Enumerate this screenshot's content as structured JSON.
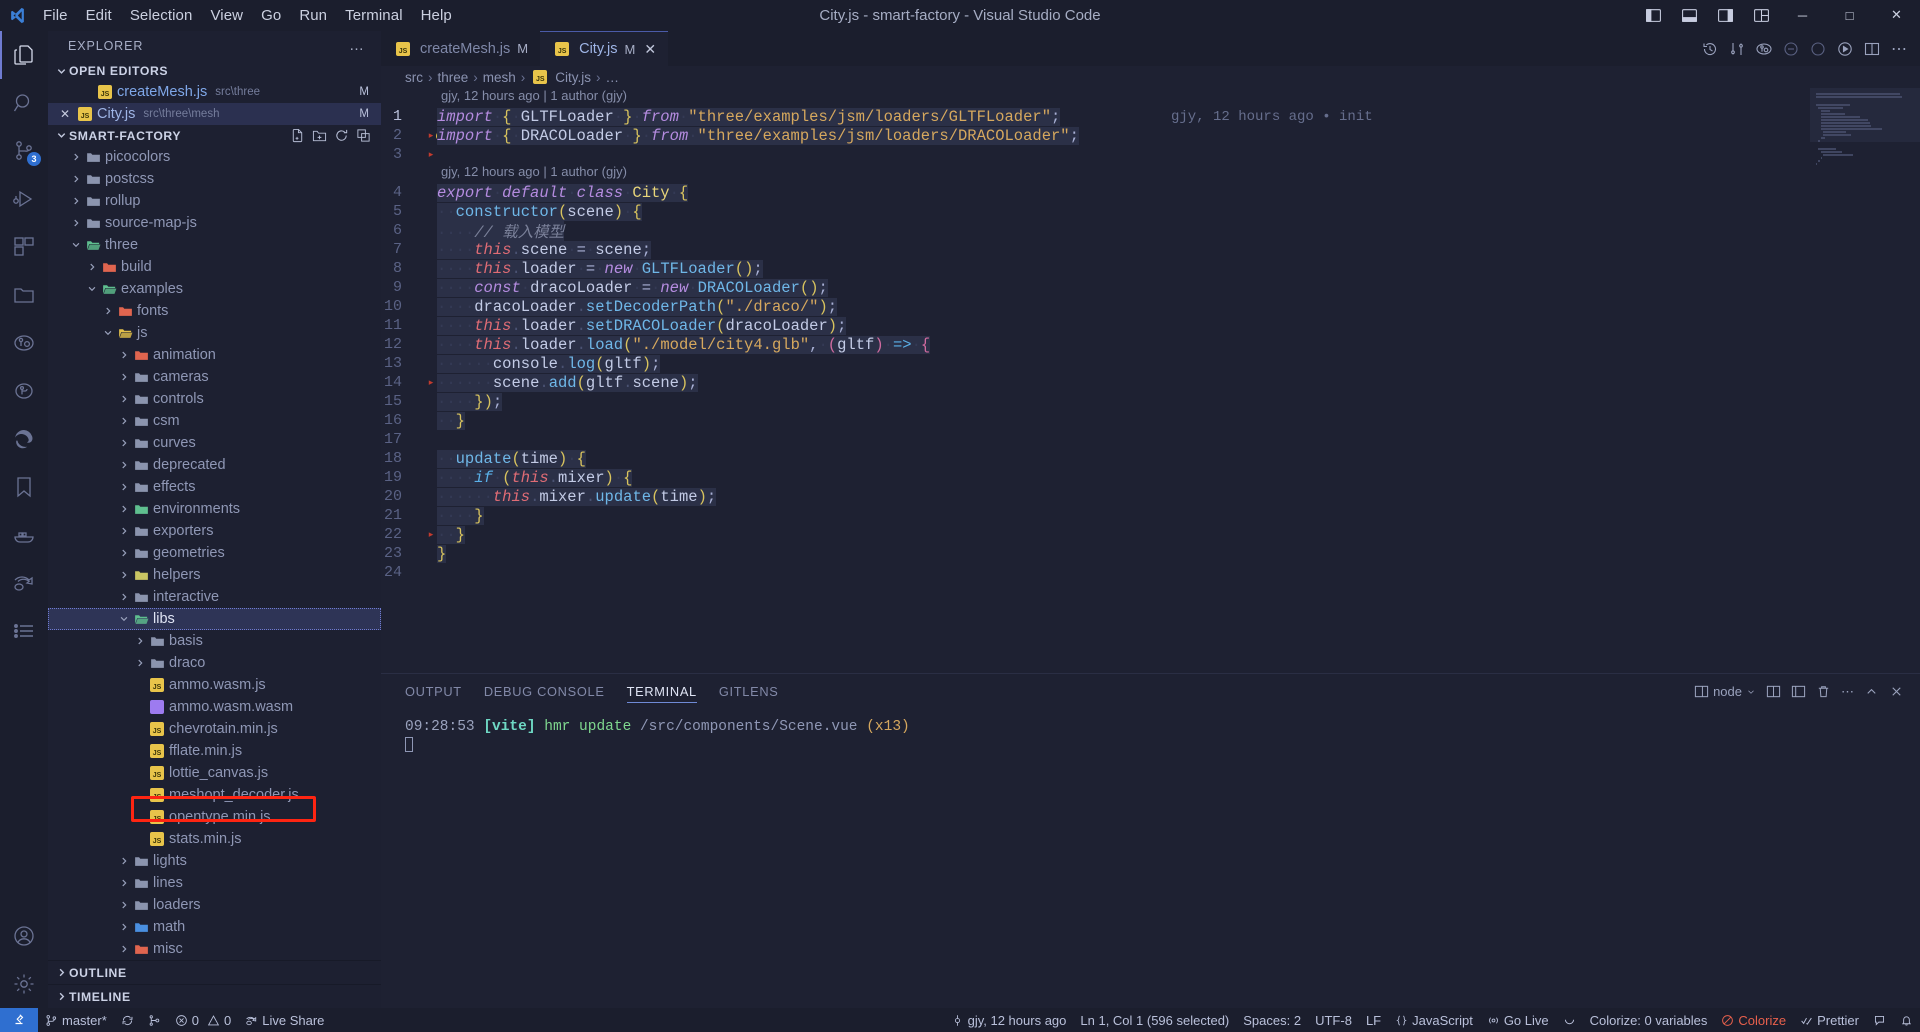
{
  "titlebar": {
    "window_title": "City.js - smart-factory - Visual Studio Code",
    "menus": [
      "File",
      "Edit",
      "Selection",
      "View",
      "Go",
      "Run",
      "Terminal",
      "Help"
    ],
    "window_buttons": {
      "minimize": "─",
      "maximize": "□",
      "close": "✕"
    }
  },
  "activitybar": {
    "items": [
      {
        "name": "explorer",
        "icon": "files-icon",
        "badge": ""
      },
      {
        "name": "search",
        "icon": "search-icon",
        "badge": ""
      },
      {
        "name": "source-control",
        "icon": "source-control-icon",
        "badge": "3"
      },
      {
        "name": "run-and-debug",
        "icon": "debug-icon",
        "badge": ""
      },
      {
        "name": "extensions",
        "icon": "extensions-icon",
        "badge": ""
      },
      {
        "name": "remote-explorer",
        "icon": "folder-icon",
        "badge": ""
      },
      {
        "name": "gitlens",
        "icon": "gitlens-icon",
        "badge": ""
      },
      {
        "name": "git-graph",
        "icon": "git-graph-icon",
        "badge": ""
      },
      {
        "name": "edge-tools",
        "icon": "edge-icon",
        "badge": ""
      },
      {
        "name": "bookmarks",
        "icon": "bookmark-icon",
        "badge": ""
      },
      {
        "name": "docker",
        "icon": "docker-icon",
        "badge": ""
      },
      {
        "name": "live-share",
        "icon": "live-share-icon",
        "badge": ""
      },
      {
        "name": "todo-tree",
        "icon": "list-icon",
        "badge": ""
      }
    ],
    "bottom": [
      {
        "name": "accounts",
        "icon": "account-icon"
      },
      {
        "name": "settings",
        "icon": "gear-icon"
      }
    ]
  },
  "sidebar": {
    "title": "EXPLORER",
    "more_label": "…",
    "open_editors": {
      "label": "OPEN EDITORS",
      "items": [
        {
          "name": "createMesh.js",
          "path": "src\\three",
          "badge": "M",
          "icon": "js-icon",
          "active": false
        },
        {
          "name": "City.js",
          "path": "src\\three\\mesh",
          "badge": "M",
          "icon": "js-icon",
          "active": true
        }
      ]
    },
    "project": {
      "label": "SMART-FACTORY",
      "actions": [
        "new-file-icon",
        "new-folder-icon",
        "refresh-icon",
        "collapse-all-icon"
      ],
      "tree": [
        {
          "label": "picocolors",
          "depth": 1,
          "type": "folder",
          "open": false,
          "color": "gray"
        },
        {
          "label": "postcss",
          "depth": 1,
          "type": "folder",
          "open": false,
          "color": "gray"
        },
        {
          "label": "rollup",
          "depth": 1,
          "type": "folder",
          "open": false,
          "color": "gray"
        },
        {
          "label": "source-map-js",
          "depth": 1,
          "type": "folder",
          "open": false,
          "color": "gray"
        },
        {
          "label": "three",
          "depth": 1,
          "type": "folder",
          "open": true,
          "color": "green"
        },
        {
          "label": "build",
          "depth": 2,
          "type": "folder",
          "open": false,
          "color": "red"
        },
        {
          "label": "examples",
          "depth": 2,
          "type": "folder",
          "open": true,
          "color": "green"
        },
        {
          "label": "fonts",
          "depth": 3,
          "type": "folder",
          "open": false,
          "color": "red"
        },
        {
          "label": "js",
          "depth": 3,
          "type": "folder",
          "open": true,
          "color": "yellow"
        },
        {
          "label": "animation",
          "depth": 4,
          "type": "folder",
          "open": false,
          "color": "red"
        },
        {
          "label": "cameras",
          "depth": 4,
          "type": "folder",
          "open": false,
          "color": "gray"
        },
        {
          "label": "controls",
          "depth": 4,
          "type": "folder",
          "open": false,
          "color": "gray"
        },
        {
          "label": "csm",
          "depth": 4,
          "type": "folder",
          "open": false,
          "color": "gray"
        },
        {
          "label": "curves",
          "depth": 4,
          "type": "folder",
          "open": false,
          "color": "gray"
        },
        {
          "label": "deprecated",
          "depth": 4,
          "type": "folder",
          "open": false,
          "color": "gray"
        },
        {
          "label": "effects",
          "depth": 4,
          "type": "folder",
          "open": false,
          "color": "gray"
        },
        {
          "label": "environments",
          "depth": 4,
          "type": "folder",
          "open": false,
          "color": "green"
        },
        {
          "label": "exporters",
          "depth": 4,
          "type": "folder",
          "open": false,
          "color": "gray"
        },
        {
          "label": "geometries",
          "depth": 4,
          "type": "folder",
          "open": false,
          "color": "gray"
        },
        {
          "label": "helpers",
          "depth": 4,
          "type": "folder",
          "open": false,
          "color": "olive"
        },
        {
          "label": "interactive",
          "depth": 4,
          "type": "folder",
          "open": false,
          "color": "gray"
        },
        {
          "label": "libs",
          "depth": 4,
          "type": "folder",
          "open": true,
          "color": "green",
          "state": "focused"
        },
        {
          "label": "basis",
          "depth": 5,
          "type": "folder",
          "open": false,
          "color": "gray"
        },
        {
          "label": "draco",
          "depth": 5,
          "type": "folder",
          "open": false,
          "color": "gray",
          "state": "highlighted"
        },
        {
          "label": "ammo.wasm.js",
          "depth": 5,
          "type": "file",
          "icon": "js-icon"
        },
        {
          "label": "ammo.wasm.wasm",
          "depth": 5,
          "type": "file",
          "icon": "wasm-icon"
        },
        {
          "label": "chevrotain.min.js",
          "depth": 5,
          "type": "file",
          "icon": "js-icon"
        },
        {
          "label": "fflate.min.js",
          "depth": 5,
          "type": "file",
          "icon": "js-icon"
        },
        {
          "label": "lottie_canvas.js",
          "depth": 5,
          "type": "file",
          "icon": "js-icon"
        },
        {
          "label": "meshopt_decoder.js",
          "depth": 5,
          "type": "file",
          "icon": "js-icon"
        },
        {
          "label": "opentype.min.js",
          "depth": 5,
          "type": "file",
          "icon": "js-icon"
        },
        {
          "label": "stats.min.js",
          "depth": 5,
          "type": "file",
          "icon": "js-icon"
        },
        {
          "label": "lights",
          "depth": 4,
          "type": "folder",
          "open": false,
          "color": "gray"
        },
        {
          "label": "lines",
          "depth": 4,
          "type": "folder",
          "open": false,
          "color": "gray"
        },
        {
          "label": "loaders",
          "depth": 4,
          "type": "folder",
          "open": false,
          "color": "gray"
        },
        {
          "label": "math",
          "depth": 4,
          "type": "folder",
          "open": false,
          "color": "blue"
        },
        {
          "label": "misc",
          "depth": 4,
          "type": "folder",
          "open": false,
          "color": "red"
        }
      ]
    },
    "outline_label": "OUTLINE",
    "timeline_label": "TIMELINE"
  },
  "editor": {
    "tabs": [
      {
        "label": "createMesh.js",
        "badge": "M",
        "icon": "js-icon",
        "active": false,
        "closable": false
      },
      {
        "label": "City.js",
        "badge": "M",
        "icon": "js-icon",
        "active": true,
        "closable": true,
        "close": "✕"
      }
    ],
    "breadcrumb": [
      "src",
      "three",
      "mesh",
      "City.js",
      "…"
    ],
    "codelens": [
      {
        "line": 1,
        "text": "gjy, 12 hours ago | 1 author (gjy)"
      },
      {
        "line": 4,
        "text": "gjy, 12 hours ago | 1 author (gjy)"
      }
    ],
    "inline_blame": "gjy, 12 hours ago • init",
    "lines": [
      {
        "n": 1,
        "text": "import { GLTFLoader } from \"three/examples/jsm/loaders/GLTFLoader\";"
      },
      {
        "n": 2,
        "text": "import { DRACOLoader } from \"three/examples/jsm/loaders/DRACOLoader\";"
      },
      {
        "n": 3,
        "text": ""
      },
      {
        "n": 4,
        "text": "export default class City {"
      },
      {
        "n": 5,
        "text": "  constructor(scene) {"
      },
      {
        "n": 6,
        "text": "    // 载入模型"
      },
      {
        "n": 7,
        "text": "    this.scene = scene;"
      },
      {
        "n": 8,
        "text": "    this.loader = new GLTFLoader();"
      },
      {
        "n": 9,
        "text": "    const dracoLoader = new DRACOLoader();"
      },
      {
        "n": 10,
        "text": "    dracoLoader.setDecoderPath(\"./draco/\");"
      },
      {
        "n": 11,
        "text": "    this.loader.setDRACOLoader(dracoLoader);"
      },
      {
        "n": 12,
        "text": "    this.loader.load(\"./model/city4.glb\", (gltf) => {"
      },
      {
        "n": 13,
        "text": "      console.log(gltf);"
      },
      {
        "n": 14,
        "text": "      scene.add(gltf.scene);"
      },
      {
        "n": 15,
        "text": "    });"
      },
      {
        "n": 16,
        "text": "  }"
      },
      {
        "n": 17,
        "text": ""
      },
      {
        "n": 18,
        "text": "  update(time) {"
      },
      {
        "n": 19,
        "text": "    if (this.mixer) {"
      },
      {
        "n": 20,
        "text": "      this.mixer.update(time);"
      },
      {
        "n": 21,
        "text": "    }"
      },
      {
        "n": 22,
        "text": "  }"
      },
      {
        "n": 23,
        "text": "}"
      },
      {
        "n": 24,
        "text": ""
      }
    ]
  },
  "panel": {
    "tabs": [
      "OUTPUT",
      "DEBUG CONSOLE",
      "TERMINAL",
      "GITLENS"
    ],
    "active_tab": "TERMINAL",
    "shell_label": "node",
    "terminal": {
      "time": "09:28:53",
      "tag": "[vite]",
      "action": "hmr update",
      "path": "/src/components/Scene.vue",
      "count": "(x13)"
    },
    "actions": [
      "split-terminal-icon",
      "new-terminal-icon",
      "layout-icon",
      "trash-icon",
      "more-icon",
      "chevron-up-icon",
      "close-icon"
    ]
  },
  "statusbar": {
    "left": [
      {
        "name": "remote-indicator",
        "icon": "remote-icon",
        "text": ""
      },
      {
        "name": "branch",
        "icon": "branch-icon",
        "text": "master*"
      },
      {
        "name": "sync",
        "icon": "sync-icon",
        "text": ""
      },
      {
        "name": "gitlens-toggle",
        "icon": "gitlens-icon",
        "text": ""
      },
      {
        "name": "problems",
        "icon": "error-icon",
        "text": "0",
        "icon2": "warning-icon",
        "text2": "0"
      },
      {
        "name": "live-share",
        "icon": "live-share-icon",
        "text": "Live Share"
      }
    ],
    "right": [
      {
        "name": "git-blame",
        "icon": "git-commit-icon",
        "text": "gjy, 12 hours ago"
      },
      {
        "name": "cursor-position",
        "icon": "",
        "text": "Ln 1, Col 1 (596 selected)"
      },
      {
        "name": "indentation",
        "icon": "",
        "text": "Spaces: 2"
      },
      {
        "name": "encoding",
        "icon": "",
        "text": "UTF-8"
      },
      {
        "name": "eol",
        "icon": "",
        "text": "LF"
      },
      {
        "name": "language-mode",
        "icon": "braces-icon",
        "text": "JavaScript"
      },
      {
        "name": "go-live",
        "icon": "broadcast-icon",
        "text": "Go Live"
      },
      {
        "name": "spinner",
        "icon": "loading-icon",
        "text": ""
      },
      {
        "name": "colorize-count",
        "icon": "",
        "text": "Colorize: 0 variables"
      },
      {
        "name": "colorize",
        "icon": "slash-circle-icon",
        "text": "Colorize",
        "color": "#e8604c"
      },
      {
        "name": "prettier",
        "icon": "check-icon",
        "text": "Prettier"
      },
      {
        "name": "feedback",
        "icon": "feedback-icon",
        "text": ""
      },
      {
        "name": "notifications",
        "icon": "bell-icon",
        "text": ""
      }
    ]
  }
}
